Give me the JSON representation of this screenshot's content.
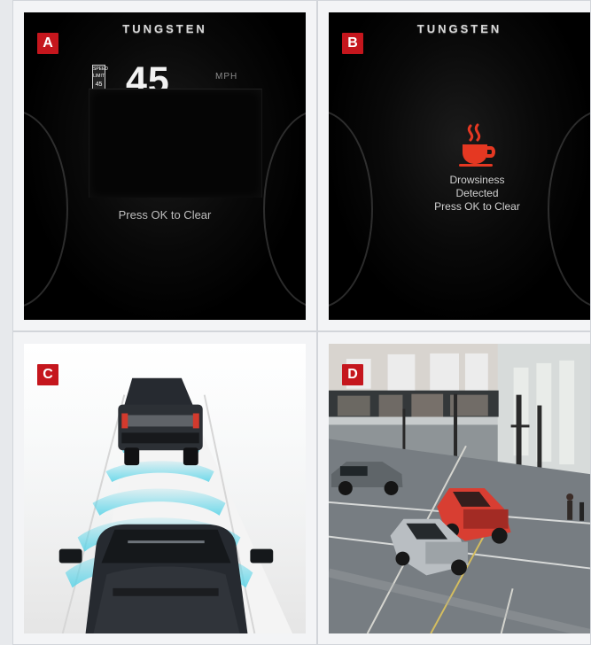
{
  "panels": {
    "a": {
      "label": "A",
      "brand": "TUNGSTEN",
      "speed_limit": {
        "top_text": "SPEED LIMIT",
        "value": "45"
      },
      "speed": "45",
      "unit": "MPH",
      "message": "Press OK to Clear"
    },
    "b": {
      "label": "B",
      "brand": "TUNGSTEN",
      "alert_line_1": "Drowsiness",
      "alert_line_2": "Detected",
      "message": "Press OK to Clear"
    },
    "c": {
      "label": "C"
    },
    "d": {
      "label": "D"
    }
  },
  "colors": {
    "label_red": "#c5161d",
    "alert_red": "#e53822",
    "sensor_cyan": "#58d4e8",
    "red_truck": "#d83e32",
    "silver_truck": "#b9bec2",
    "dark_truck": "#262a30"
  },
  "icons": {
    "coffee": "coffee-cup-icon",
    "speed_limit": "speed-limit-sign-icon",
    "truck": "pickup-truck-icon"
  }
}
